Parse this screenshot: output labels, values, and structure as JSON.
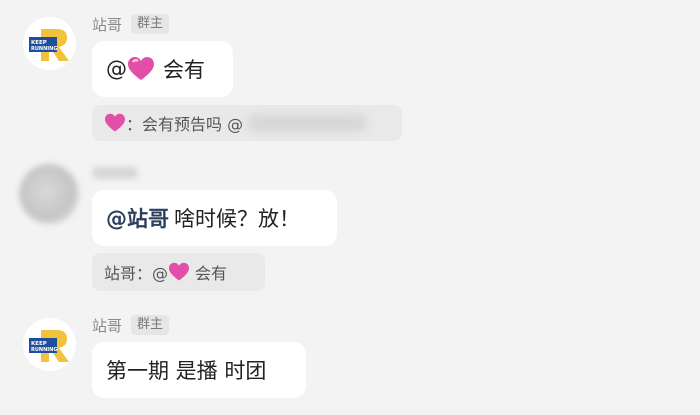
{
  "messages": [
    {
      "sender": "站哥",
      "role_badge": "群主",
      "avatar_logo": "KEEP RUNNING",
      "text_prefix": "@",
      "text": "会有",
      "quote_prefix": "：会有预告吗 @"
    },
    {
      "mention": "@站哥",
      "text": "啥时候？放！",
      "quote_sender": "站哥：@",
      "quote_text": "会有"
    },
    {
      "sender": "站哥",
      "role_badge": "群主",
      "avatar_logo": "KEEP RUNNING",
      "text": "第一期 是播 时团"
    }
  ],
  "colors": {
    "background": "#f3f3f3",
    "bubble": "#ffffff",
    "quote": "#e9e9e9",
    "mention": "#2c3f5e",
    "heart": "#e14fa8"
  }
}
